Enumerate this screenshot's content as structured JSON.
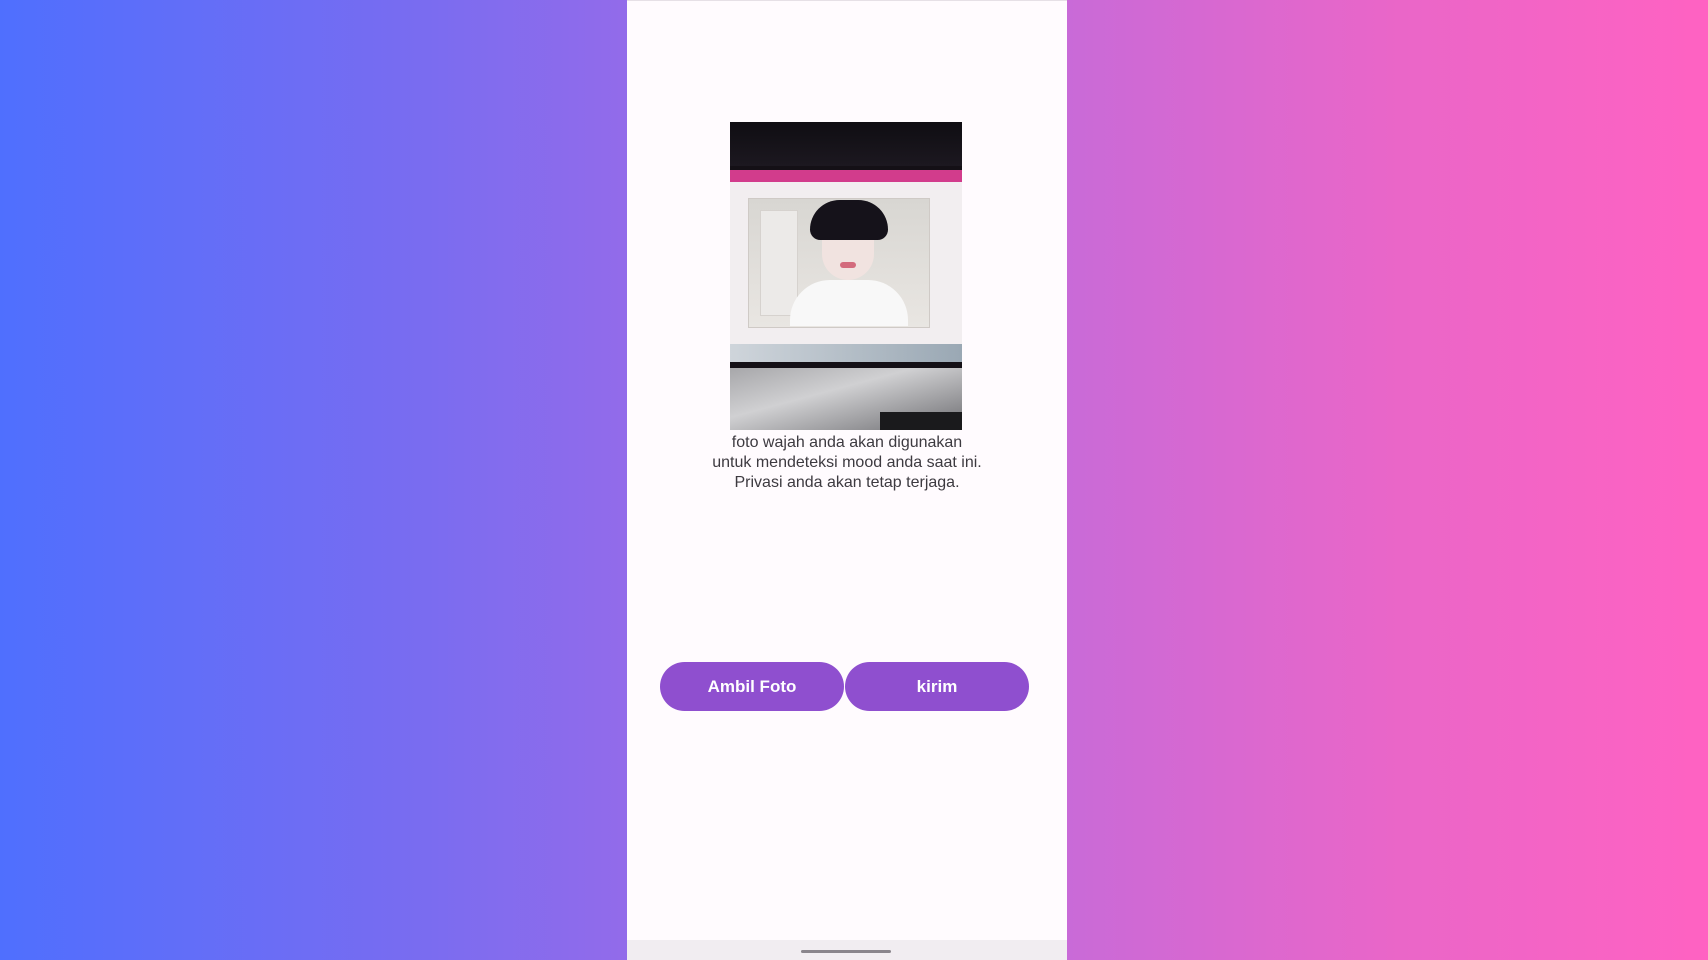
{
  "screen": {
    "caption_lines": [
      "foto wajah anda akan digunakan",
      "untuk mendeteksi mood anda saat ini.",
      "Privasi anda akan tetap terjaga."
    ]
  },
  "buttons": {
    "take_photo": "Ambil Foto",
    "send": "kirim"
  },
  "colors": {
    "button": "#8f4fcf",
    "background_left": "#4f6ffe",
    "background_right": "#ff62c2",
    "screen": "#fffbfe"
  }
}
